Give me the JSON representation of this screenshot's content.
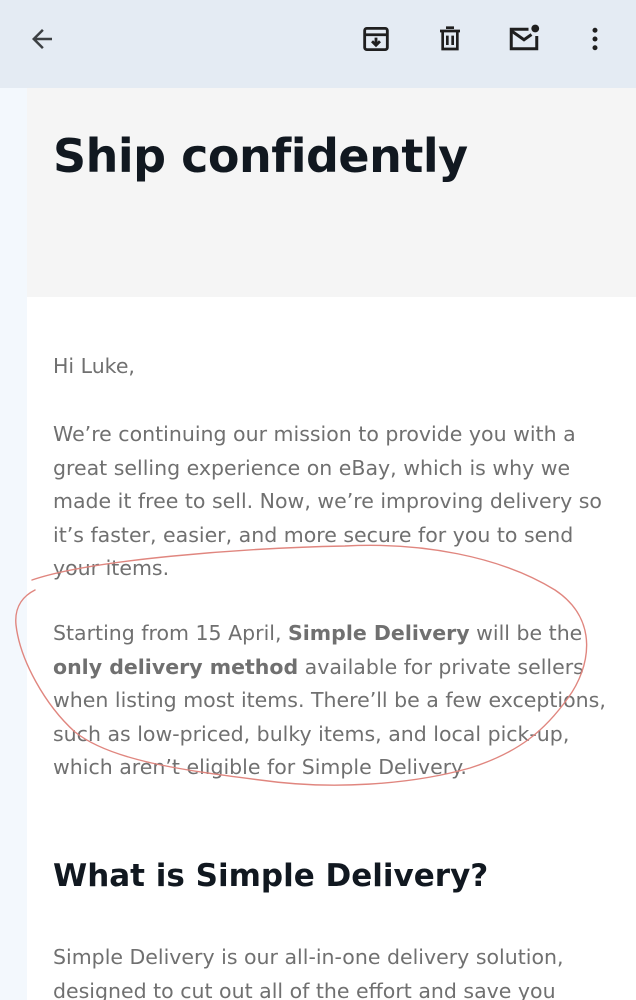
{
  "toolbar": {
    "back_icon": "arrow-left-icon",
    "archive_icon": "archive-icon",
    "delete_icon": "trash-icon",
    "mark_unread_icon": "mail-unread-icon",
    "more_icon": "more-vert-icon"
  },
  "email": {
    "headline": "Ship confidently",
    "greeting": "Hi Luke,",
    "paragraph1": "We’re continuing our mission to provide you with a great selling experience on eBay, which is why we made it free to sell. Now, we’re improving delivery so it’s faster, easier, and more secure for you to send your items.",
    "paragraph2": {
      "part1": "Starting from 15 April, ",
      "bold1": "Simple Delivery",
      "part2": " will be the ",
      "bold2": "only delivery method",
      "part3": " available for private sellers when listing most items. There’ll be a few exceptions, such as low-priced, bulky items, and local pick-up, which aren’t eligible for Simple Delivery."
    },
    "section_heading": "What is Simple Delivery?",
    "paragraph3": "Simple Delivery is our all-in-one delivery solution, designed to cut out all of the effort and save you"
  },
  "colors": {
    "app_bar": "#e4ebf3",
    "hero_bg": "#f5f5f5",
    "heading_text": "#111820",
    "body_text": "#707070",
    "annotation_ink": "#e0867f"
  }
}
